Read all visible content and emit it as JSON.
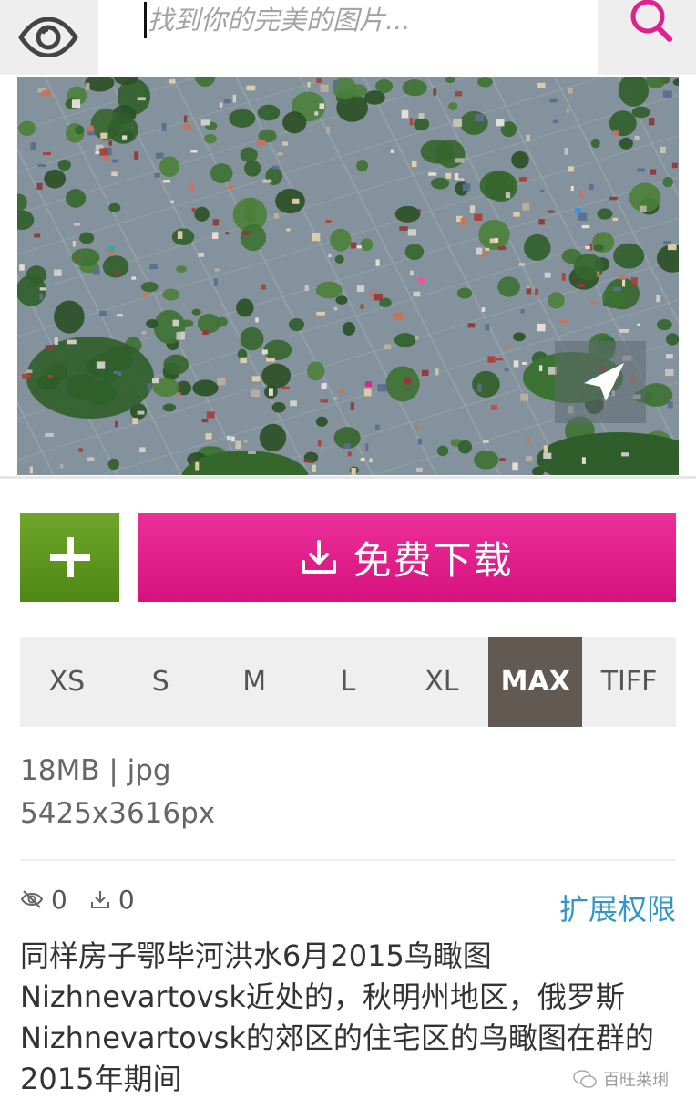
{
  "search": {
    "placeholder": "找到你的完美的图片..."
  },
  "icons": {
    "eye": "eye-icon",
    "search": "search-icon",
    "plus": "plus-icon",
    "download": "download-icon",
    "views": "views-icon",
    "downloads": "downloads-icon",
    "image_nav": "arrow-pointer-icon",
    "watermark": "wechat-icon"
  },
  "colors": {
    "accent_pink": "#e11d8a",
    "add_green": "#5e9820",
    "active_tab": "#625a52",
    "link_blue": "#3496c8"
  },
  "actions": {
    "download_label": "免费下载"
  },
  "sizes": {
    "options": [
      "XS",
      "S",
      "M",
      "L",
      "XL",
      "MAX",
      "TIFF"
    ],
    "selected": "MAX"
  },
  "file": {
    "info": "18MB | jpg",
    "dimensions": "5425x3616px"
  },
  "stats": {
    "views": "0",
    "downloads": "0"
  },
  "extend_link": "扩展权限",
  "description": "同样房子鄂毕河洪水6月2015鸟瞰图Nizhnevartovsk近处的，秋明州地区，俄罗斯Nizhnevartovsk的郊区的住宅区的鸟瞰图在群的2015年期间",
  "watermark": "百旺莱琍"
}
